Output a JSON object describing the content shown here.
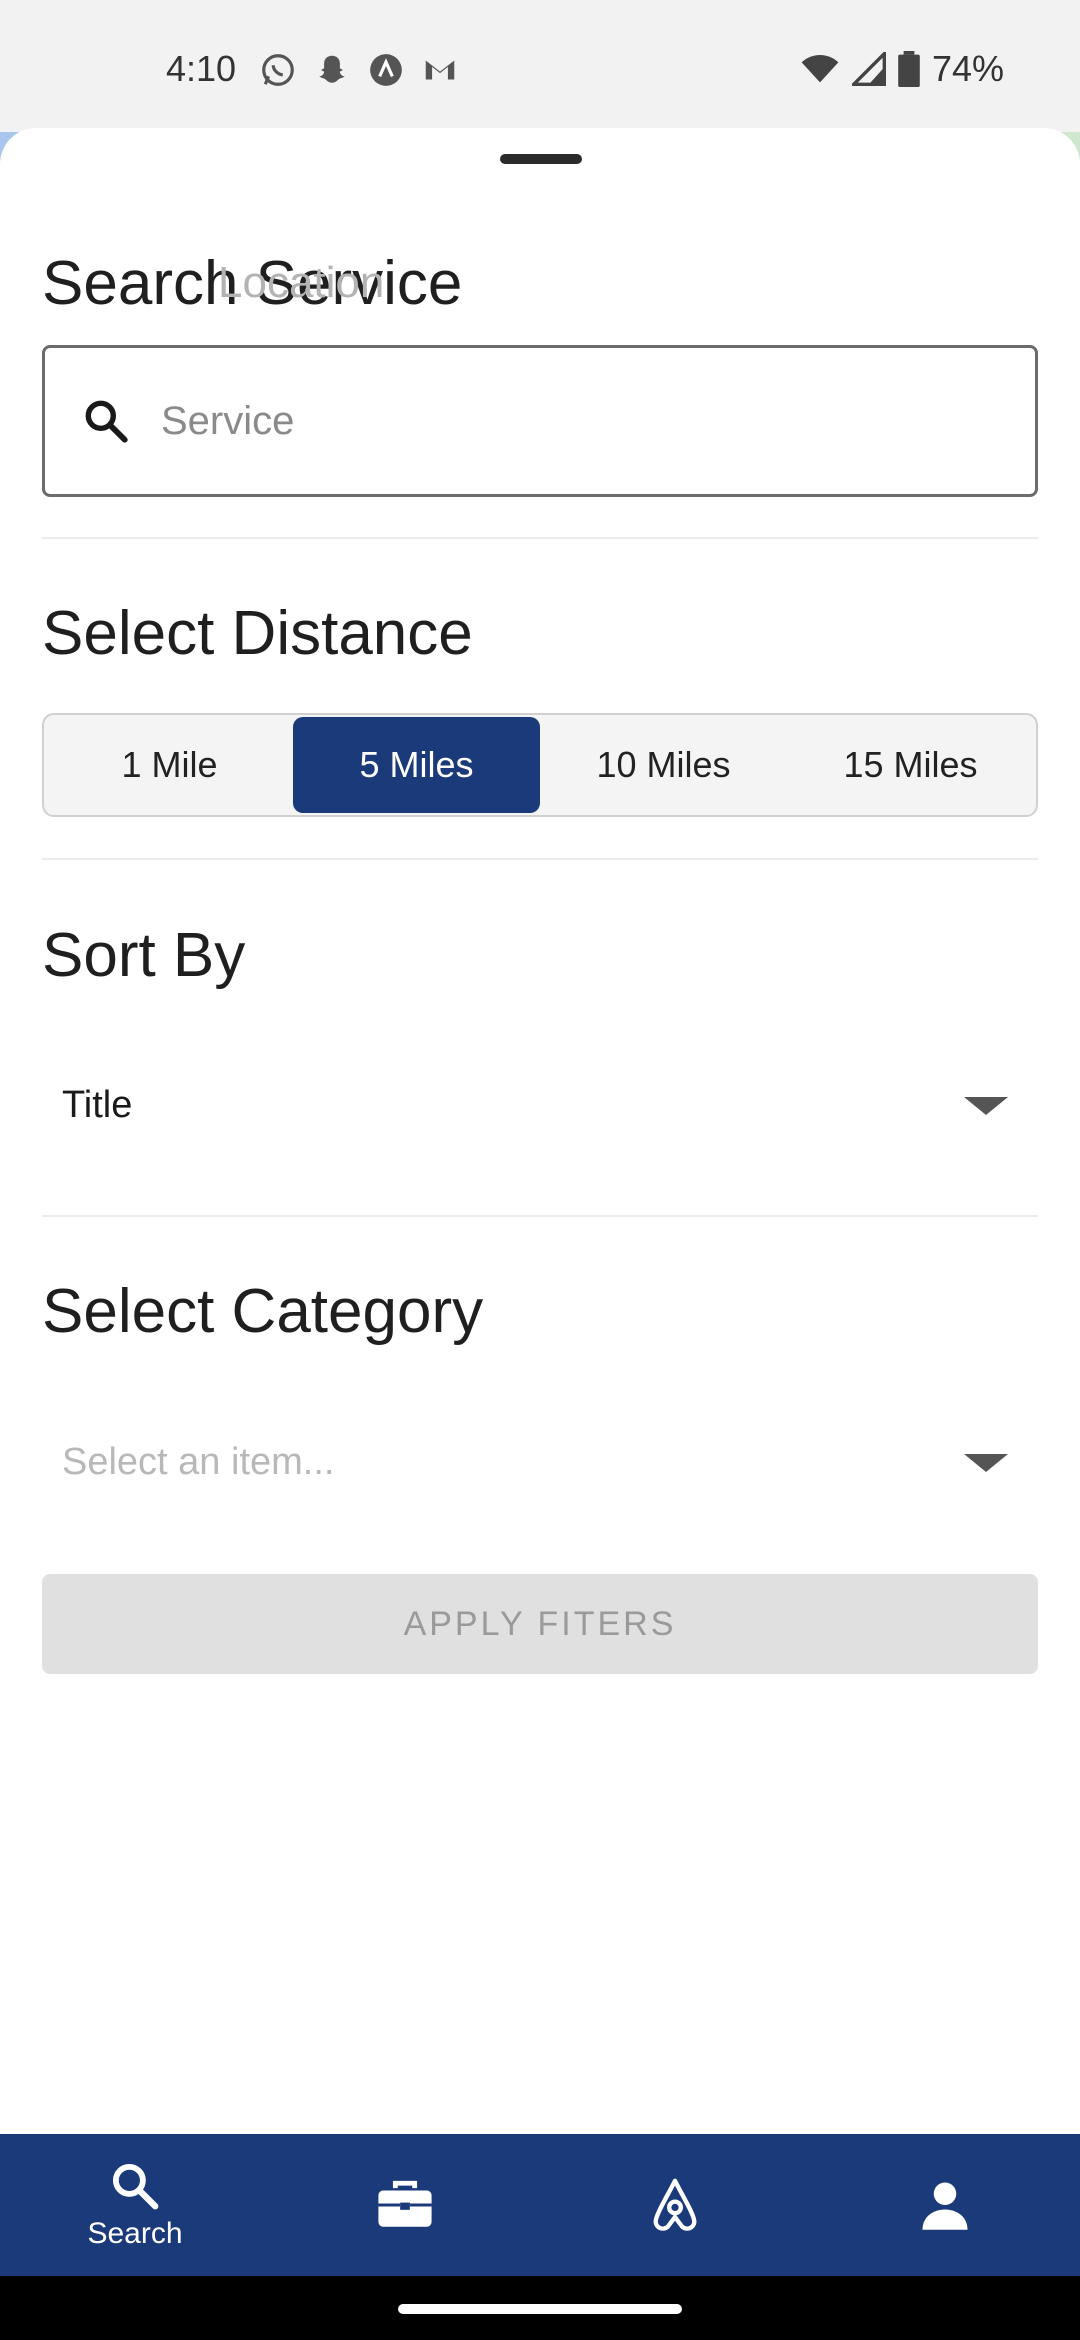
{
  "status_bar": {
    "time": "4:10",
    "battery": "74%",
    "notification_icons": [
      "whatsapp-icon",
      "snapchat-icon",
      "app-a-icon",
      "gmail-icon"
    ]
  },
  "search_service": {
    "title": "Search Service",
    "ghost_text": "Location",
    "placeholder": "Service"
  },
  "distance": {
    "title": "Select Distance",
    "options": [
      "1 Mile",
      "5 Miles",
      "10 Miles",
      "15 Miles"
    ],
    "selected": "5 Miles"
  },
  "sort_by": {
    "title": "Sort By",
    "value": "Title"
  },
  "category": {
    "title": "Select Category",
    "placeholder": "Select an item..."
  },
  "apply_button_label": "APPLY FITERS",
  "bottom_nav": {
    "items": [
      {
        "icon": "search-icon",
        "label": "Search",
        "active": true
      },
      {
        "icon": "briefcase-icon",
        "label": "",
        "active": false
      },
      {
        "icon": "airbnb-icon",
        "label": "",
        "active": false
      },
      {
        "icon": "person-icon",
        "label": "",
        "active": false
      }
    ]
  },
  "colors": {
    "primary": "#1b3a7a",
    "disabled_button": "#e0e0e0"
  }
}
